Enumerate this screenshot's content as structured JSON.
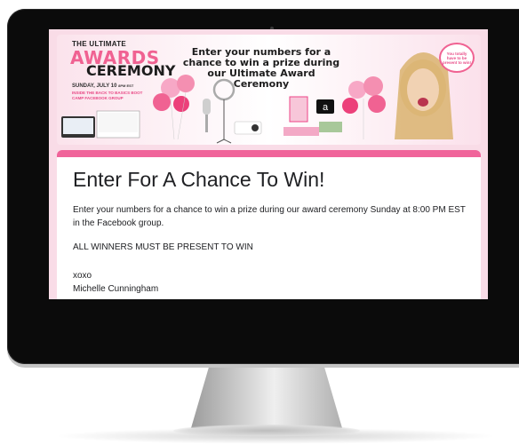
{
  "banner": {
    "the": "THE ULTIMATE",
    "awards": "AWARDS",
    "ceremony": "CEREMONY",
    "date": "SUNDAY, JULY 10",
    "time": "8PM EST",
    "group": "INSIDE THE BACK TO BASICS BOOT CAMP FACEBOOK GROUP",
    "headline": "Enter your numbers for a chance to win a prize during our Ultimate Award Ceremony",
    "bubble": "You totally have to be present to win!",
    "accent": "#f06292"
  },
  "form": {
    "title": "Enter For A Chance To Win!",
    "description": "Enter your numbers for a chance to win a prize during our award ceremony Sunday at 8:00 PM EST in the Facebook group.",
    "notice": "ALL WINNERS MUST BE PRESENT TO WIN",
    "signoff": "xoxo",
    "author": "Michelle Cunningham",
    "accent": "#f0649a"
  }
}
